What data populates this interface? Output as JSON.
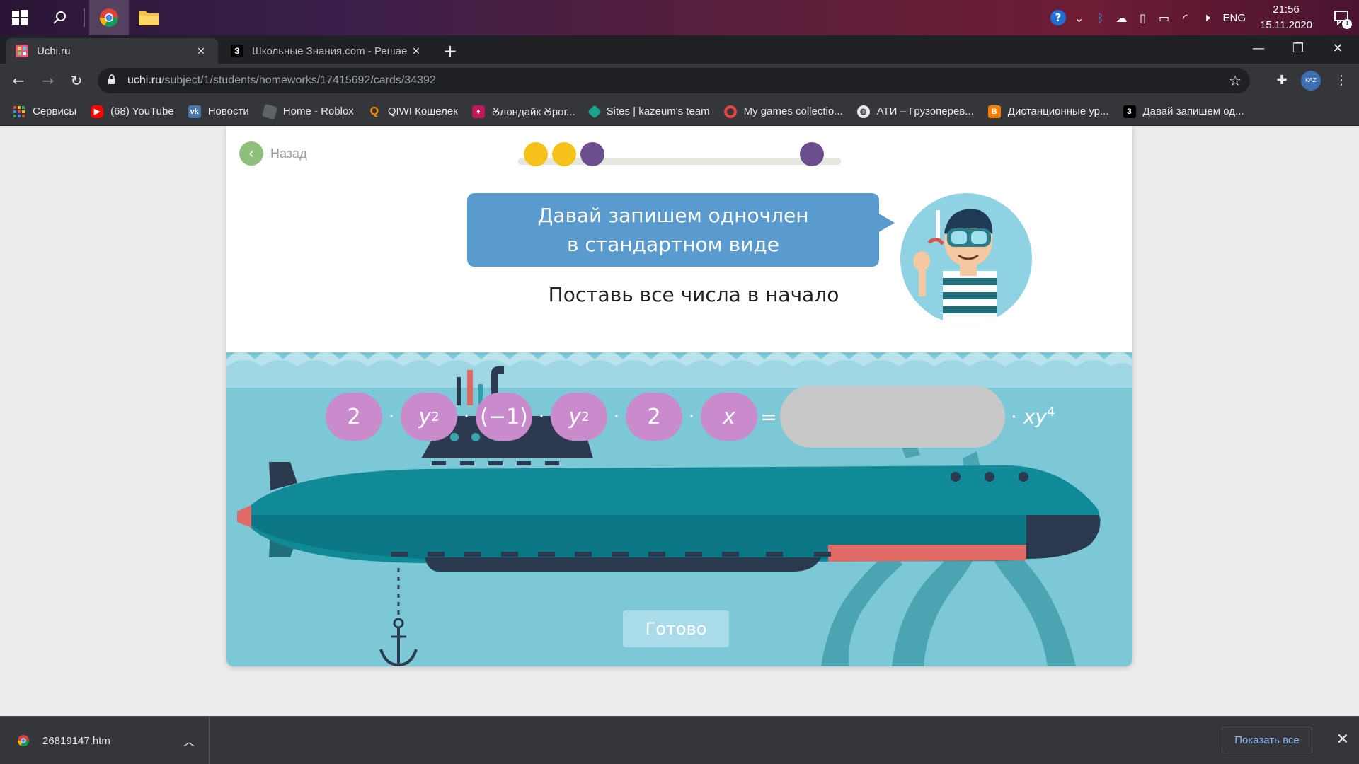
{
  "tray": {
    "lang": "ENG",
    "time": "21:56",
    "date": "15.11.2020",
    "notifications": "1"
  },
  "tabs": [
    {
      "title": "Uchi.ru",
      "active": true
    },
    {
      "title": "Школьные Знания.com - Решае",
      "active": false
    }
  ],
  "address": {
    "domain": "uchi.ru",
    "path": "/subject/1/students/homeworks/17415692/cards/34392"
  },
  "bookmarks": [
    {
      "label": "Сервисы",
      "icon": "apps-icon",
      "color": "#e8453c"
    },
    {
      "label": "(68) YouTube",
      "icon": "youtube-icon",
      "color": "#ff0000"
    },
    {
      "label": "Новости",
      "icon": "vk-icon",
      "color": "#4a76a8"
    },
    {
      "label": "Home - Roblox",
      "icon": "roblox-icon",
      "color": "#5f6368"
    },
    {
      "label": "QIWI Кошелек",
      "icon": "qiwi-icon",
      "color": "#ff8c00"
    },
    {
      "label": "Ꙋлондайк Ꙋрог...",
      "icon": "klondike-icon",
      "color": "#c2185b"
    },
    {
      "label": "Sites | kazeum's team",
      "icon": "sites-icon",
      "color": "#1aa38c"
    },
    {
      "label": "My games collectio...",
      "icon": "chrome-ring-icon",
      "color": "#e8453c"
    },
    {
      "label": "АТИ – Грузоперев...",
      "icon": "globe-icon",
      "color": "#9aa0a6"
    },
    {
      "label": "Дистанционные ур...",
      "icon": "blogger-icon",
      "color": "#f57d00"
    },
    {
      "label": "Давай запишем од...",
      "icon": "znanija-icon",
      "color": "#000000"
    }
  ],
  "lesson": {
    "back_label": "Назад",
    "bubble_line1": "Давай запишем одночлен",
    "bubble_line2": "в стандартном виде",
    "instruction": "Поставь все числа в начало",
    "ready_label": "Готово",
    "progress": {
      "dots": [
        {
          "color": "#f6c21a"
        },
        {
          "color": "#f6c21a"
        },
        {
          "color": "#6c4f8e"
        },
        {
          "color": "#6c4f8e"
        }
      ]
    },
    "expression": {
      "factors": [
        "2",
        "y2",
        "(−1)",
        "y2",
        "2",
        "x"
      ],
      "equals": "=",
      "answer_value": "",
      "suffix": "xy4"
    }
  },
  "downloads": {
    "file": "26819147.htm",
    "show_all": "Показать все"
  },
  "colors": {
    "accent_blue": "#5a9bcf",
    "pill_purple": "#c98bcc",
    "sea": "#7cc8d6",
    "submarine": "#0f8a96"
  }
}
